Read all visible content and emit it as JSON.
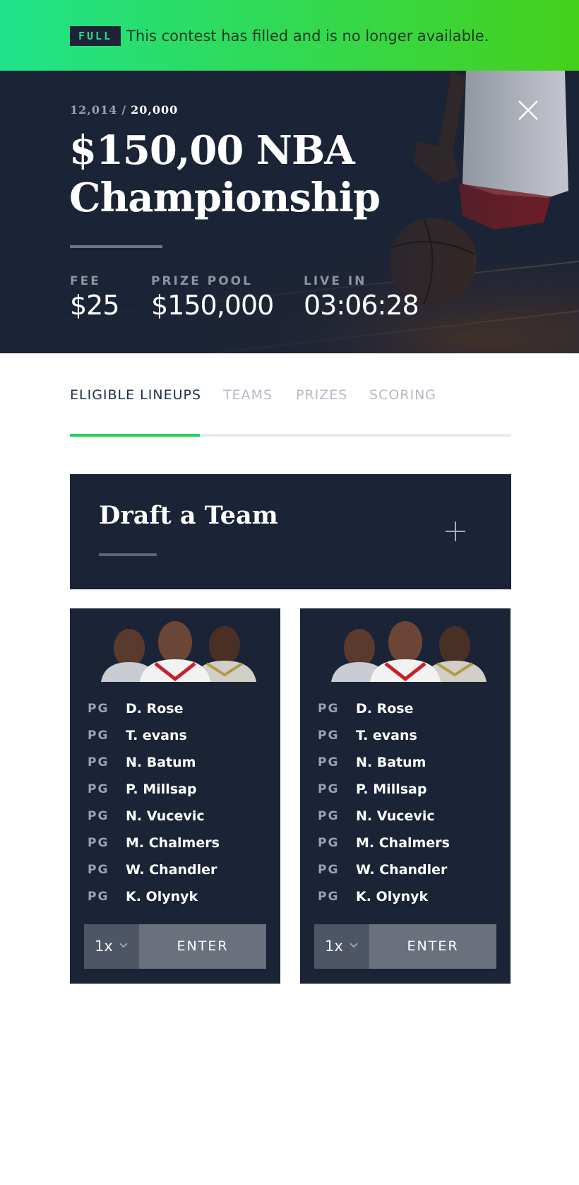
{
  "banner": {
    "badge": "FULL",
    "message": "This contest has filled and is no longer available."
  },
  "contest": {
    "entries_current": "12,014",
    "separator": "/",
    "entries_total": "20,000",
    "title": "$150,00 NBA Championship",
    "stats": [
      {
        "label": "FEE",
        "value": "$25"
      },
      {
        "label": "PRIZE POOL",
        "value": "$150,000"
      },
      {
        "label": "LIVE IN",
        "value": "03:06:28"
      }
    ]
  },
  "tabs": [
    {
      "label": "ELIGIBLE LINEUPS",
      "active": true
    },
    {
      "label": "TEAMS",
      "active": false
    },
    {
      "label": "PRIZES",
      "active": false
    },
    {
      "label": "SCORING",
      "active": false
    }
  ],
  "draft": {
    "title": "Draft a Team"
  },
  "lineups": [
    {
      "players": [
        {
          "pos": "PG",
          "name": "D. Rose"
        },
        {
          "pos": "PG",
          "name": "T. evans"
        },
        {
          "pos": "PG",
          "name": "N. Batum"
        },
        {
          "pos": "PG",
          "name": "P. Millsap"
        },
        {
          "pos": "PG",
          "name": "N. Vucevic"
        },
        {
          "pos": "PG",
          "name": "M. Chalmers"
        },
        {
          "pos": "PG",
          "name": "W. Chandler"
        },
        {
          "pos": "PG",
          "name": "K. Olynyk"
        }
      ],
      "multiplier": "1x",
      "enter_label": "ENTER"
    },
    {
      "players": [
        {
          "pos": "PG",
          "name": "D. Rose"
        },
        {
          "pos": "PG",
          "name": "T. evans"
        },
        {
          "pos": "PG",
          "name": "N. Batum"
        },
        {
          "pos": "PG",
          "name": "P. Millsap"
        },
        {
          "pos": "PG",
          "name": "N. Vucevic"
        },
        {
          "pos": "PG",
          "name": "M. Chalmers"
        },
        {
          "pos": "PG",
          "name": "W. Chandler"
        },
        {
          "pos": "PG",
          "name": "K. Olynyk"
        }
      ],
      "multiplier": "1x",
      "enter_label": "ENTER"
    }
  ],
  "colors": {
    "banner_start": "#1fe38a",
    "banner_end": "#45d01c",
    "navy": "#1b2336",
    "accent_green": "#26d259"
  },
  "icons": {
    "close": "close-icon",
    "plus": "plus-icon",
    "chevron": "chevron-down-icon"
  }
}
